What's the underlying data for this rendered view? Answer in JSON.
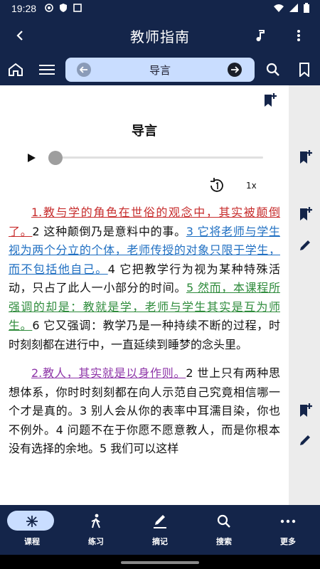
{
  "status_bar": {
    "time": "19:28"
  },
  "app_bar": {
    "title": "教师指南"
  },
  "toolbar": {
    "nav_label": "导言"
  },
  "lesson": {
    "title": "导言",
    "speed": "1x"
  },
  "paragraph1": {
    "s1": "1.教与学的角色在世俗的观念中，其实被颠倒了。",
    "s2": "2 这种颠倒乃是意料中的事。",
    "s3": "3 它将老师与学生视为两个分立的个体，老师传授的对象只限于学生，而不包括他自己。",
    "s4": "4 它把教学行为视为某种特殊活动，只占了此人一小部分的时间。",
    "s5": "5 然而，本课程所强调的却是：教就是学，老师与学生其实是互为师生。",
    "s6": "6 它又强调：教学乃是一种持续不断的过程，时时刻刻都在进行中，一直延续到睡梦的念头里。"
  },
  "paragraph2": {
    "s1": "2.教人，其实就是以身作则。",
    "s2": "2 世上只有两种思想体系，你时时刻刻都在向人示范自己究竟相信哪一个才是真的。3 别人会从你的表率中耳濡目染，你也不例外。4 问题不在于你愿不愿意教人，而是你根本没有选择的余地。5 我们可以这样"
  },
  "bottom_nav": [
    {
      "label": "课程",
      "icon": "course-icon",
      "active": true
    },
    {
      "label": "练习",
      "icon": "walk-icon",
      "active": false
    },
    {
      "label": "摘记",
      "icon": "note-icon",
      "active": false
    },
    {
      "label": "搜索",
      "icon": "search-icon",
      "active": false
    },
    {
      "label": "更多",
      "icon": "more-icon",
      "active": false
    }
  ],
  "colors": {
    "primary": "#14254a",
    "accent": "#c9ddff",
    "highlight_red": "#c72c2c",
    "highlight_blue": "#1f6fc2",
    "highlight_green": "#2e8b3b",
    "highlight_purple": "#8e35a8"
  }
}
